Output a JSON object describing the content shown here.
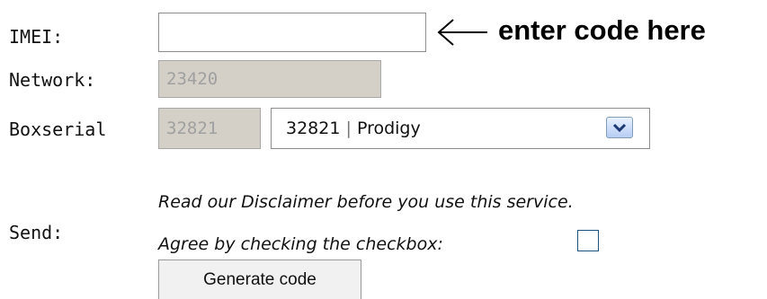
{
  "form": {
    "imei": {
      "label": "IMEI:",
      "value": "",
      "hint": "enter code here"
    },
    "network": {
      "label": "Network:",
      "value": "23420"
    },
    "boxserial": {
      "label": "Boxserial",
      "value": "32821",
      "select_code": "32821",
      "select_separator": "|",
      "select_name": "Prodigy"
    },
    "send": {
      "label": "Send:",
      "disclaimer": "Read our Disclaimer before you use this service.",
      "agree": "Agree by checking the checkbox:",
      "agree_checked": false,
      "button_label": "Generate code"
    }
  },
  "icons": {
    "hint_arrow": "left-arrow-icon",
    "dropdown": "chevron-down-icon"
  },
  "colors": {
    "disabled_field_bg": "#d4d0c8",
    "disabled_field_text": "#a0a0a0",
    "dropdown_button_gradient_top": "#e9f1ff",
    "dropdown_button_gradient_bottom": "#b7cdf5",
    "checkbox_border": "#1c5180"
  }
}
